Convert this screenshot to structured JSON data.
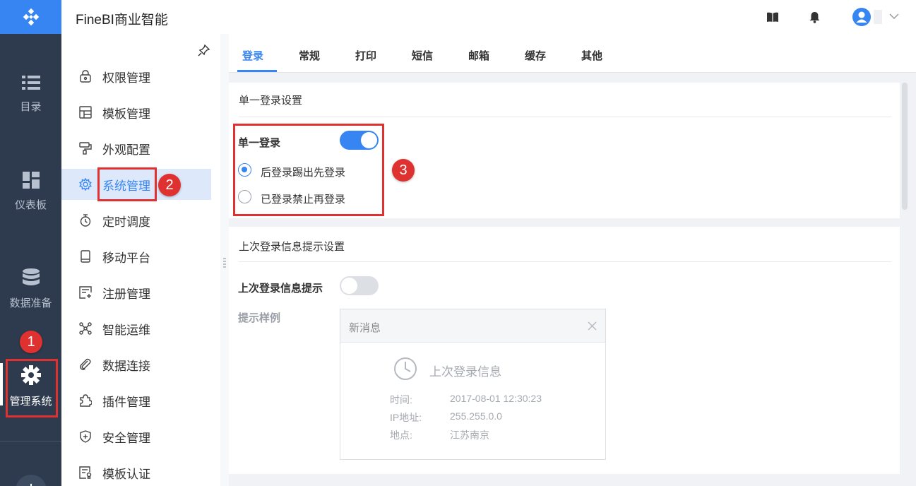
{
  "app": {
    "title": "FineBI商业智能"
  },
  "rail": {
    "items": [
      {
        "label": "目录",
        "icon": "list-icon"
      },
      {
        "label": "仪表板",
        "icon": "dashboard-icon"
      },
      {
        "label": "数据准备",
        "icon": "database-icon"
      },
      {
        "label": "管理系统",
        "icon": "gear-icon",
        "active": true
      }
    ],
    "plus": "+"
  },
  "menu": {
    "items": [
      {
        "label": "权限管理",
        "icon": "lock-icon"
      },
      {
        "label": "模板管理",
        "icon": "template-icon"
      },
      {
        "label": "外观配置",
        "icon": "paint-roller-icon"
      },
      {
        "label": "系统管理",
        "icon": "gear-icon",
        "active": true
      },
      {
        "label": "定时调度",
        "icon": "stopwatch-icon"
      },
      {
        "label": "移动平台",
        "icon": "tablet-icon"
      },
      {
        "label": "注册管理",
        "icon": "register-icon"
      },
      {
        "label": "智能运维",
        "icon": "network-icon"
      },
      {
        "label": "数据连接",
        "icon": "paperclip-icon"
      },
      {
        "label": "插件管理",
        "icon": "puzzle-icon"
      },
      {
        "label": "安全管理",
        "icon": "shield-icon"
      },
      {
        "label": "模板认证",
        "icon": "certificate-icon"
      }
    ]
  },
  "tabs": [
    {
      "label": "登录",
      "active": true
    },
    {
      "label": "常规"
    },
    {
      "label": "打印"
    },
    {
      "label": "短信"
    },
    {
      "label": "邮箱"
    },
    {
      "label": "缓存"
    },
    {
      "label": "其他"
    }
  ],
  "sso": {
    "section_title": "单一登录设置",
    "toggle_label": "单一登录",
    "enabled": true,
    "options": [
      {
        "label": "后登录踢出先登录",
        "selected": true
      },
      {
        "label": "已登录禁止再登录",
        "selected": false
      }
    ]
  },
  "last_login": {
    "section_title": "上次登录信息提示设置",
    "toggle_label": "上次登录信息提示",
    "enabled": false,
    "sample_label": "提示样例",
    "sample": {
      "header": "新消息",
      "title": "上次登录信息",
      "rows": [
        {
          "key": "时间:",
          "value": "2017-08-01 12:30:23"
        },
        {
          "key": "IP地址:",
          "value": "255.255.0.0"
        },
        {
          "key": "地点:",
          "value": "江苏南京"
        }
      ]
    }
  },
  "annotations": {
    "one": "1",
    "two": "2",
    "three": "3"
  },
  "colors": {
    "accent": "#3685f2",
    "rail": "#2e3b4e",
    "annotation": "#e03131"
  }
}
